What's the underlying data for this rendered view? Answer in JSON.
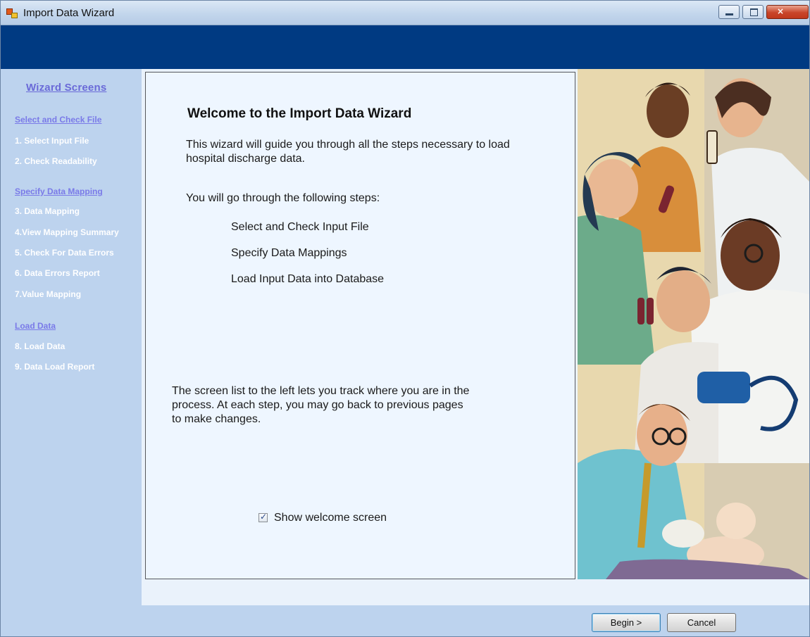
{
  "window": {
    "title": "Import Data Wizard",
    "controls": {
      "minimize": "minimize",
      "maximize": "maximize",
      "close": "×"
    }
  },
  "sidebar": {
    "title": "Wizard Screens",
    "sections": [
      {
        "label": "Select and Check File",
        "items": [
          "1. Select Input File",
          "2. Check Readability"
        ]
      },
      {
        "label": "Specify Data Mapping",
        "items": [
          "3. Data Mapping",
          "4.View Mapping Summary",
          "5. Check For Data Errors",
          "6. Data Errors Report",
          "7.Value Mapping"
        ]
      },
      {
        "label": "Load Data",
        "items": [
          "8. Load Data",
          "9. Data Load Report"
        ]
      }
    ]
  },
  "main": {
    "title": "Welcome to the Import Data Wizard",
    "intro_line1": "This wizard will guide you through all the steps necessary to load",
    "intro_line2": "hospital discharge data.",
    "steps_heading": "You will go through the following steps:",
    "steps": [
      "Select and Check Input File",
      "Specify Data Mappings",
      "Load Input Data into Database"
    ],
    "note_line1": "The screen list to the left lets you track where you are in the",
    "note_line2": "process.  At each step, you may go back to previous pages",
    "note_line3": "to make changes.",
    "show_welcome_label": "Show welcome screen",
    "show_welcome_checked": true
  },
  "footer": {
    "begin_label": "Begin >",
    "cancel_label": "Cancel"
  },
  "colors": {
    "header_band": "#003a82",
    "sidebar_bg": "#bdd3ee",
    "section_link": "#7a7ae8",
    "panel_bg": "#eef6ff"
  },
  "illustration": {
    "icon": "medical-staff-illustration"
  }
}
